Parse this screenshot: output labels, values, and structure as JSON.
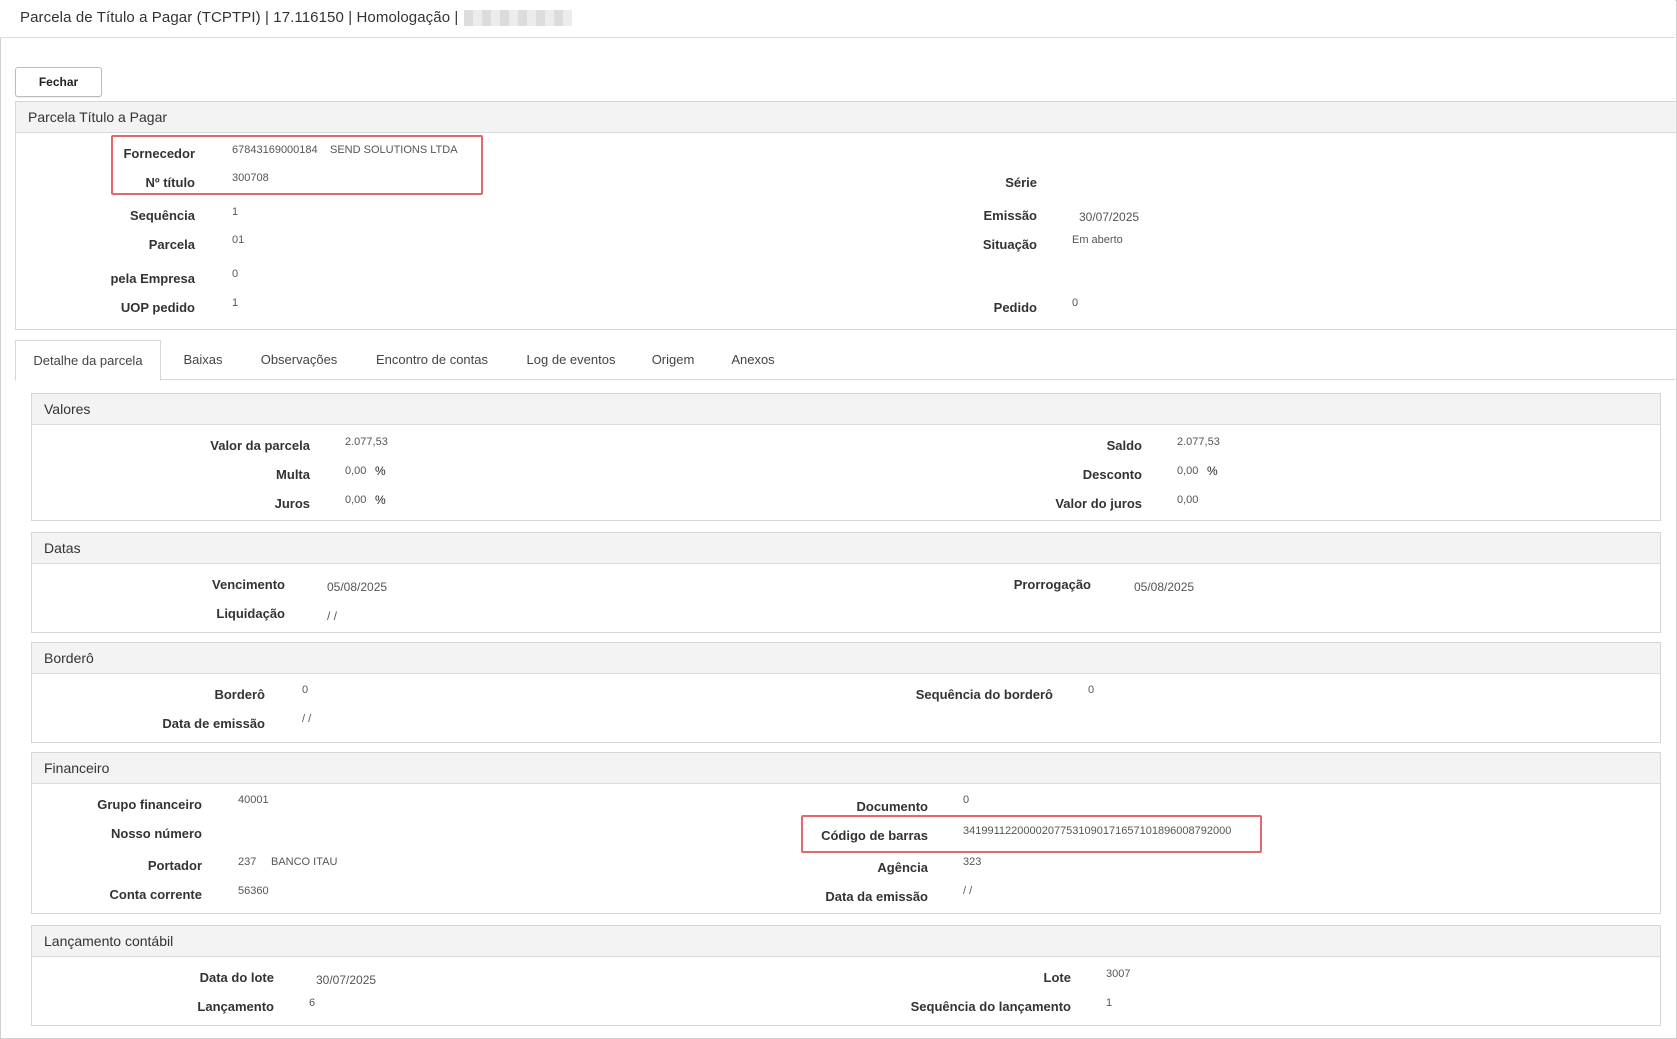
{
  "window": {
    "title": "Parcela de Título a Pagar (TCPTPI) | 17.116150 | Homologação |"
  },
  "toolbar": {
    "close_label": "Fechar"
  },
  "header_panel": {
    "title": "Parcela Título a Pagar",
    "fornecedor_label": "Fornecedor",
    "fornecedor_code": "67843169000184",
    "fornecedor_name": "SEND SOLUTIONS LTDA",
    "numero_titulo_label": "Nº título",
    "numero_titulo": "300708",
    "serie_label": "Série",
    "serie": "",
    "sequencia_label": "Sequência",
    "sequencia": "1",
    "emissao_label": "Emissão",
    "emissao": "30/07/2025",
    "parcela_label": "Parcela",
    "parcela": "01",
    "situacao_label": "Situação",
    "situacao": "Em aberto",
    "pela_empresa_label": "pela Empresa",
    "pela_empresa": "0",
    "uop_pedido_label": "UOP pedido",
    "uop_pedido": "1",
    "pedido_label": "Pedido",
    "pedido": "0"
  },
  "tabs": [
    {
      "label": "Detalhe da parcela",
      "active": true
    },
    {
      "label": "Baixas"
    },
    {
      "label": "Observações"
    },
    {
      "label": "Encontro de contas"
    },
    {
      "label": "Log de eventos"
    },
    {
      "label": "Origem"
    },
    {
      "label": "Anexos"
    }
  ],
  "valores": {
    "title": "Valores",
    "valor_parcela_label": "Valor da parcela",
    "valor_parcela": "2.077,53",
    "saldo_label": "Saldo",
    "saldo": "2.077,53",
    "multa_label": "Multa",
    "multa": "0,00",
    "desconto_label": "Desconto",
    "desconto": "0,00",
    "juros_label": "Juros",
    "juros": "0,00",
    "valor_juros_label": "Valor do juros",
    "valor_juros": "0,00",
    "percent_symbol": "%"
  },
  "datas": {
    "title": "Datas",
    "vencimento_label": "Vencimento",
    "vencimento": "05/08/2025",
    "prorrogacao_label": "Prorrogação",
    "prorrogacao": "05/08/2025",
    "liquidacao_label": "Liquidação",
    "liquidacao": "/ /"
  },
  "bordero": {
    "title": "Borderô",
    "bordero_label": "Borderô",
    "bordero": "0",
    "sequencia_bordero_label": "Sequência do borderô",
    "sequencia_bordero": "0",
    "data_emissao_label": "Data de emissão",
    "data_emissao": "/ /"
  },
  "financeiro": {
    "title": "Financeiro",
    "grupo_financeiro_label": "Grupo financeiro",
    "grupo_financeiro": "40001",
    "documento_label": "Documento",
    "documento": "0",
    "nosso_numero_label": "Nosso número",
    "nosso_numero": "",
    "codigo_barras_label": "Código de barras",
    "codigo_barras": "34199112200002077531090171657101896008792000",
    "portador_label": "Portador",
    "portador_code": "237",
    "portador_name": "BANCO ITAU",
    "agencia_label": "Agência",
    "agencia": "323",
    "conta_corrente_label": "Conta corrente",
    "conta_corrente": "56360",
    "data_emissao_label": "Data da emissão",
    "data_emissao": "/ /"
  },
  "lancamento": {
    "title": "Lançamento contábil",
    "data_lote_label": "Data do lote",
    "data_lote": "30/07/2025",
    "lote_label": "Lote",
    "lote": "3007",
    "lancamento_label": "Lançamento",
    "lancamento": "6",
    "sequencia_lancamento_label": "Sequência do lançamento",
    "sequencia_lancamento": "1"
  },
  "colors": {
    "highlight": "#e6676b",
    "panel_header_bg": "#f3f3f3"
  }
}
